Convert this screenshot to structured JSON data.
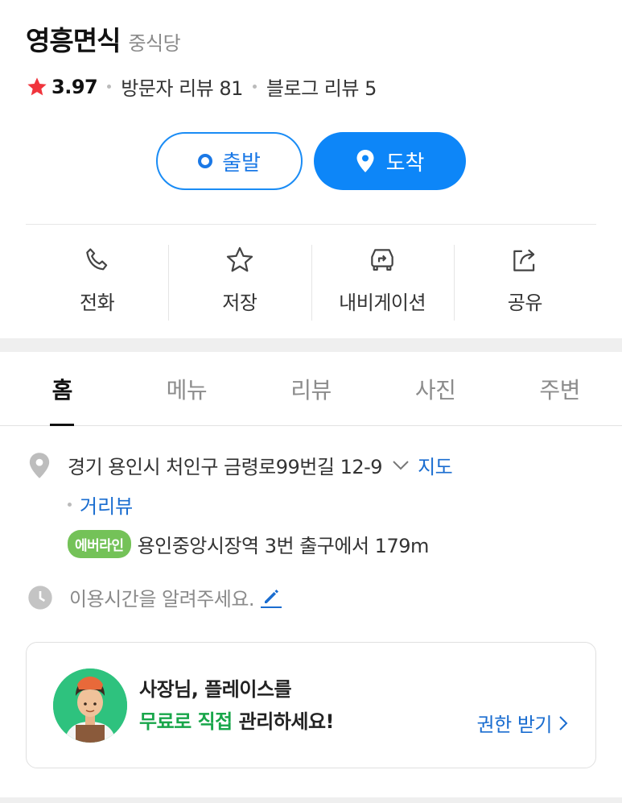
{
  "place": {
    "name": "영흥면식",
    "category": "중식당"
  },
  "rating": {
    "score": "3.97",
    "visitor_reviews": "방문자 리뷰 81",
    "blog_reviews": "블로그 리뷰 5"
  },
  "route": {
    "depart_label": "출발",
    "arrive_label": "도착"
  },
  "actions": [
    {
      "label": "전화",
      "icon": "phone-icon"
    },
    {
      "label": "저장",
      "icon": "star-outline-icon"
    },
    {
      "label": "내비게이션",
      "icon": "car-navigation-icon"
    },
    {
      "label": "공유",
      "icon": "share-icon"
    }
  ],
  "tabs": [
    "홈",
    "메뉴",
    "리뷰",
    "사진",
    "주변"
  ],
  "address": {
    "text": "경기 용인시 처인구 금령로99번길 12-9",
    "map_link": "지도",
    "street_view_link": "거리뷰",
    "subway_line": "에버라인",
    "subway_directions": "용인중앙시장역 3번 출구에서 179m"
  },
  "hours": {
    "text": "이용시간을 알려주세요."
  },
  "owner_card": {
    "line1": "사장님, 플레이스를",
    "highlight": "무료로 직접",
    "line2_rest": " 관리하세요!",
    "link_label": "권한 받기"
  },
  "colors": {
    "accent": "#0d86f8",
    "link": "#1a6dd0",
    "star": "#f0343c",
    "green": "#18a64a",
    "subway_badge": "#74c258"
  }
}
